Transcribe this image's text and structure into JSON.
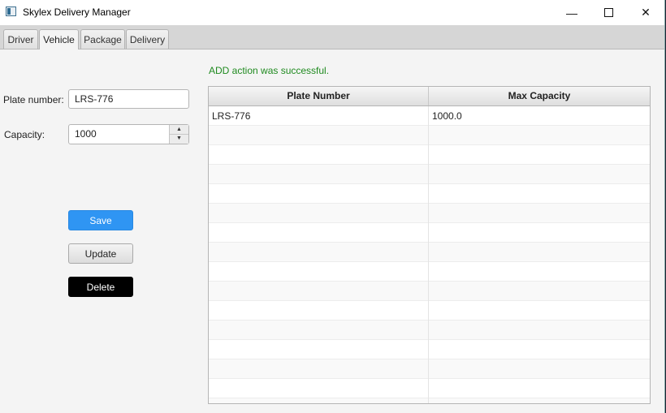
{
  "window": {
    "title": "Skylex Delivery Manager",
    "controls": {
      "minimize": "—",
      "maximize": "",
      "close": "✕"
    }
  },
  "tabs": [
    {
      "label": "Driver",
      "active": false
    },
    {
      "label": "Vehicle",
      "active": true
    },
    {
      "label": "Package",
      "active": false
    },
    {
      "label": "Delivery",
      "active": false
    }
  ],
  "form": {
    "plate_label": "Plate number:",
    "plate_value": "LRS-776",
    "capacity_label": "Capacity:",
    "capacity_value": "1000",
    "spinner_up": "▲",
    "spinner_down": "▼"
  },
  "buttons": {
    "save": "Save",
    "update": "Update",
    "delete": "Delete"
  },
  "status_message": "ADD action was successful.",
  "table": {
    "columns": [
      "Plate Number",
      "Max Capacity"
    ],
    "rows": [
      [
        "LRS-776",
        "1000.0"
      ],
      [
        "",
        ""
      ],
      [
        "",
        ""
      ],
      [
        "",
        ""
      ],
      [
        "",
        ""
      ],
      [
        "",
        ""
      ],
      [
        "",
        ""
      ],
      [
        "",
        ""
      ],
      [
        "",
        ""
      ],
      [
        "",
        ""
      ],
      [
        "",
        ""
      ],
      [
        "",
        ""
      ],
      [
        "",
        ""
      ],
      [
        "",
        ""
      ],
      [
        "",
        ""
      ],
      [
        "",
        ""
      ]
    ]
  },
  "colors": {
    "save_button": "#2f95f3",
    "delete_button": "#000000",
    "status_text": "#1f8a1f"
  }
}
